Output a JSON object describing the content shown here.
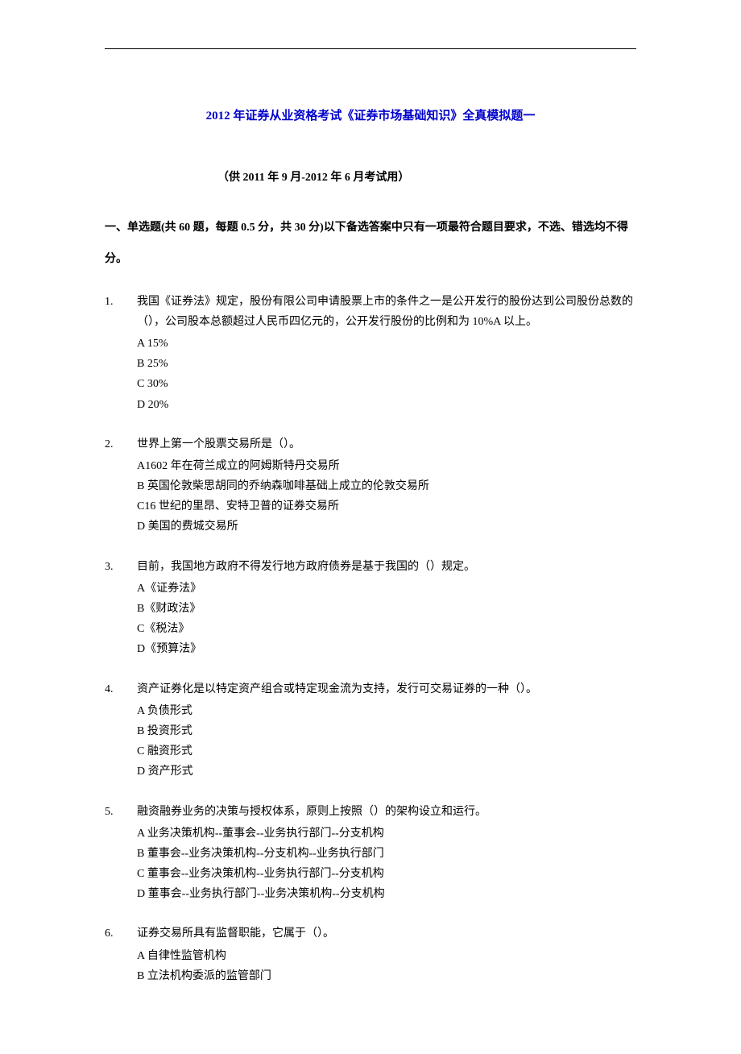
{
  "title": "2012 年证券从业资格考试《证券市场基础知识》全真模拟题一",
  "subtitle": "（供 2011 年 9 月-2012 年 6 月考试用）",
  "instructions": "一、单选题(共 60 题，每题 0.5 分，共 30 分)以下备选答案中只有一项最符合题目要求，不选、错选均不得分。",
  "questions": [
    {
      "num": "1.",
      "text": "我国《证券法》规定，股份有限公司申请股票上市的条件之一是公开发行的股份达到公司股份总数的（），公司股本总额超过人民币四亿元的，公开发行股份的比例和为 10%A 以上。",
      "options": [
        "A 15%",
        "B 25%",
        "C 30%",
        "D 20%"
      ]
    },
    {
      "num": "2.",
      "text": "世界上第一个股票交易所是（）。",
      "options": [
        "A1602 年在荷兰成立的阿姆斯特丹交易所",
        "B 英国伦敦柴思胡同的乔纳森咖啡基础上成立的伦敦交易所",
        "C16 世纪的里昂、安特卫普的证券交易所",
        "D 美国的费城交易所"
      ]
    },
    {
      "num": "3.",
      "text": "目前，我国地方政府不得发行地方政府债券是基于我国的（）规定。",
      "options": [
        "A《证券法》",
        "B《财政法》",
        "C《税法》",
        "D《预算法》"
      ]
    },
    {
      "num": "4.",
      "text": "资产证券化是以特定资产组合或特定现金流为支持，发行可交易证券的一种（）。",
      "options": [
        "A 负债形式",
        "B 投资形式",
        "C 融资形式",
        "D 资产形式"
      ]
    },
    {
      "num": "5.",
      "text": "融资融券业务的决策与授权体系，原则上按照（）的架构设立和运行。",
      "options": [
        "A 业务决策机构--董事会--业务执行部门--分支机构",
        "B 董事会--业务决策机构--分支机构--业务执行部门",
        "C 董事会--业务决策机构--业务执行部门--分支机构",
        "D 董事会--业务执行部门--业务决策机构--分支机构"
      ]
    },
    {
      "num": "6.",
      "text": "证券交易所具有监督职能，它属于（）。",
      "options": [
        "A 自律性监管机构",
        "B 立法机构委派的监管部门"
      ]
    }
  ]
}
